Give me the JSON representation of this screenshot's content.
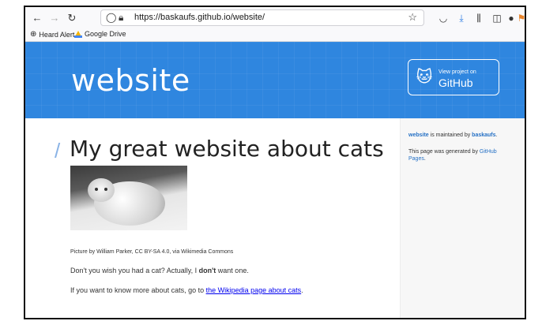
{
  "browser": {
    "url": "https://baskaufs.github.io/website/",
    "bookmarks": [
      "Heard Alert",
      "Google Drive"
    ]
  },
  "header": {
    "site_title": "website",
    "github_button": {
      "small": "View project on",
      "big": "GitHub"
    }
  },
  "main": {
    "heading": "My great website about cats",
    "image_caption": "Picture by William Parker, CC BY-SA 4.0, via Wikimedia Commons",
    "para1": {
      "before": "Don't you wish you had a cat? Actually, I ",
      "bold": "don't",
      "after": " want one."
    },
    "para2": {
      "before": "If you want to know more about cats, go to ",
      "link": "the Wikipedia page about cats",
      "after": "."
    }
  },
  "sidebar": {
    "maintained": {
      "project": "website",
      "middle": " is maintained by ",
      "user": "baskaufs",
      "end": "."
    },
    "generated": {
      "before": "This page was generated by ",
      "link": "GitHub Pages",
      "after": "."
    }
  },
  "colors": {
    "header_bg": "#2f86df",
    "link": "#2671c5"
  }
}
